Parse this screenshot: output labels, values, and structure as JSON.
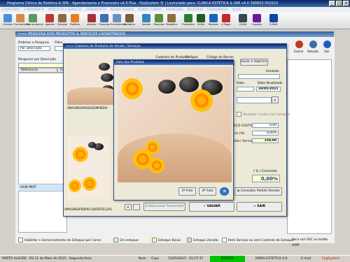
{
  "window": {
    "title": "Programa Clínica de Estética & SPA - Agendamento e Financeiro v4.0 Plus - FpqSystem ® | Licenciado para: CLINICA ESTETICA & SPA v4.0 390653 002023"
  },
  "menu": [
    "CADASTROS",
    "ATENDIMENTO",
    "PRODUTOS E SERVIÇOS",
    "ATENDIMENTO",
    "PEDIDO VENDAS",
    "PEDIDO COMPRA",
    "FINANCEIRO",
    "RELATÓRIO",
    "FERRAMENTAS",
    "AJUDA"
  ],
  "toolbar": [
    {
      "label": "Clientes",
      "color": "#4a90d9"
    },
    {
      "label": "Funcionários",
      "color": "#d98c4a"
    },
    {
      "label": "Fornecedores",
      "color": "#5a9b5a"
    },
    {
      "label": "Agenda",
      "color": "#c0392b"
    },
    {
      "label": "Estoque",
      "color": "#8e6b3f"
    },
    {
      "label": "Estética",
      "color": "#e67e22"
    },
    {
      "label": "Atender",
      "color": "#a83232"
    },
    {
      "label": "Pesquisa",
      "color": "#3d6db5"
    },
    {
      "label": "Encomendar",
      "color": "#6c8ebf"
    },
    {
      "label": "Relatório",
      "color": "#7a5c3e"
    },
    {
      "label": "Vendas",
      "color": "#2e86c1"
    },
    {
      "label": "Pesquisa",
      "color": "#5b8e3a"
    },
    {
      "label": "Relatório",
      "color": "#8d6e3f"
    },
    {
      "label": "Financeiro",
      "color": "#2e7d32"
    },
    {
      "label": "CAIXA",
      "color": "#1b5e20"
    },
    {
      "label": "Receber",
      "color": "#1565c0"
    },
    {
      "label": "A Pagar",
      "color": "#c62828"
    },
    {
      "label": "CAIXA",
      "color": "#37474f"
    },
    {
      "label": "Suporte",
      "color": "#6a1b9a"
    },
    {
      "label": "E-MAIL",
      "color": "#0d47a1"
    }
  ],
  "section_title": ">>> PESQUISA DOS PRODUTOS & SERVIÇOS CADASTRADOS",
  "search": {
    "order_label": "Ordenar a Pesquisa",
    "order_value": "Por Descrição",
    "filter_label": "Filtro",
    "search_label": "Pesquisar por Descrição",
    "col_reference": "Referencia",
    "col_code": "Có"
  },
  "right_actions": [
    {
      "label": "Excluir",
      "color": "#c0392b"
    },
    {
      "label": "Relação",
      "color": "#3a6ea5"
    },
    {
      "label": "Sair",
      "color": "#1f5fbf"
    }
  ],
  "list_item_hair": "HAIR MIST",
  "product_dialog": {
    "title": ">>> Cadastro de Produtos de Venda / Serviços",
    "tab_produtos": "Cadastro de Produtos",
    "codigos": "Códigos",
    "codigo_barras": "Código de Barras",
    "gerar_imprimir": "Gerar e Imprimir",
    "unidade": "Unidade",
    "data_label": "Data",
    "data_atualizado_label": "Data Atualizado",
    "data_atualizado_value": "10/05/2015",
    "atualizar_custos": "Atualizar Custos nas Compras",
    "preco_custo_label": "PREÇO CUSTO",
    "preco_custo_value": "0,00",
    "margem_label": "Lucro (%)",
    "margem_value": "0,00%",
    "venda_label": "Venda / Serviço",
    "venda_value": "150,00",
    "comissao_label": "( % ) Comissão",
    "comissao_value": "0,00%",
    "consultar_pedido": "Consultar Pedido Vendas",
    "relacionar_fornecedor": "Relacionar Fornecedor",
    "salvar": "SALVAR",
    "sair": "SAIR",
    "image_path_top": "\\IMAGENS\\MASSAGEMPEDRA",
    "image_path_bottom": "\\IMAGENS\\PEDRAS QUENTES2.JPG"
  },
  "photo_dialog": {
    "title": "Foto dos Produtos",
    "foto1": "1ª Foto",
    "foto2": "2ª Foto"
  },
  "legend": {
    "habilitar": "Habilitar o Gerenciamento do Estoque por Cores",
    "em_estoque": "Em estoque",
    "estoque_baixo": "Estoque Baixo",
    "estoque_zerado": "Estoque Zerado",
    "item_servico": "Item Serviço ou sem Controle de Estoque",
    "para_sair": "Para sair ESC ou botão SAIR",
    "colors": {
      "em_estoque": "#ccffcc",
      "estoque_baixo": "#ffff99",
      "estoque_zerado": "#ffcccc",
      "item_servico": "#ffffff"
    }
  },
  "statusbar": {
    "city_date": "PORTO ALEGRE - RS 11 de Maio de 2015 - Segunda-feira",
    "num": "Num",
    "caps": "Caps",
    "date": "11/05/2015",
    "time": "01:27:37",
    "master": "MASTER",
    "demo": "DEMO ESTETICA 4.0",
    "email": "E-mail",
    "brand": "FpqSystem"
  }
}
